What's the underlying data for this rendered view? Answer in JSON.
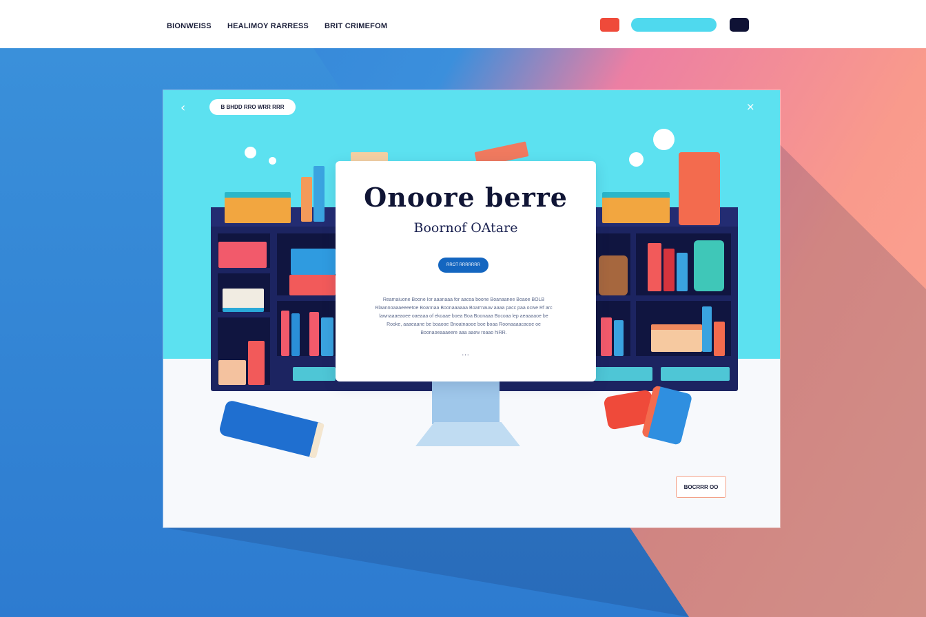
{
  "nav": {
    "links": [
      "BIONWEISS",
      "HEALIMOY RARRESS",
      "BRIT CRIMEFOM"
    ],
    "buttons": {
      "red": "",
      "cyan": "",
      "navy": ""
    }
  },
  "card": {
    "back_icon": "‹",
    "pill_label": "B BHDD RRO WRR RRR",
    "close_icon": "×"
  },
  "popup": {
    "title": "Onoore  berre",
    "subtitle": "Boornof OAtare",
    "button_label": "RROT RRRRRRR",
    "body": "Reamaiuone  Boone  Ior  aaanaaa  for aacoa  boone  Boanaanee  Boaoe  BOLB Rlaannoaaaeeeetoe  Boannaa  Boonaaaaaa  Boarrnauw  aaaa  pacc  paa  ocwe Rf  arc  lawnaaaeaoee  oaeaaa  of ekoaae  boea  Boa  Boonaaa  Bocoaa lep aeaaaaoe  be  Rooke,  aaaeaane  be  boaooe  Bnoatnaooe  boe  boaa Roonaaaacacoe  oe  Boonaoeaaaeere  aaa  aaow  roaao  hiRR.",
    "dots": "...",
    "footer_button": "BOCRRR OO"
  },
  "colors": {
    "sky": "#5ce1f0",
    "shelf": "#1c2461",
    "accent_blue": "#1466c0",
    "accent_red": "#ef4a3a",
    "accent_cyan": "#4fd9ee"
  }
}
